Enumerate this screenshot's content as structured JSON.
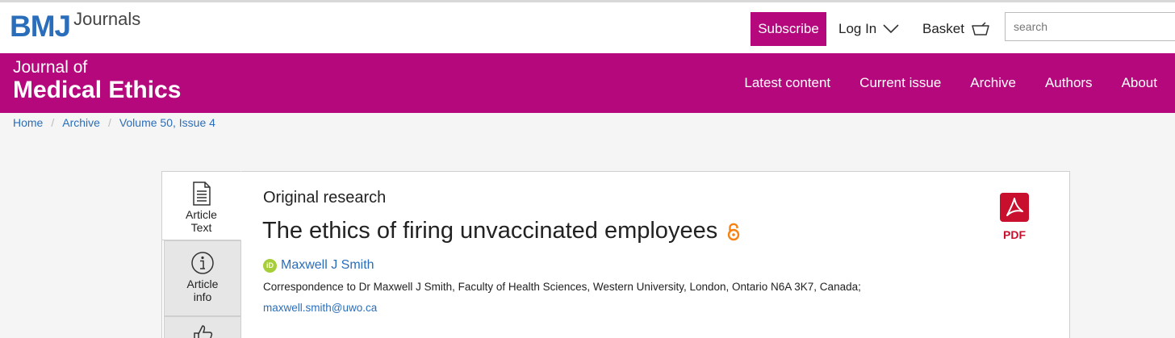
{
  "header": {
    "logo_bmj": "BMJ",
    "logo_journals": "Journals",
    "subscribe_label": "Subscribe",
    "login_label": "Log In",
    "basket_label": "Basket",
    "search_placeholder": "search"
  },
  "journal": {
    "title_line1": "Journal of",
    "title_line2": "Medical Ethics",
    "nav": [
      "Latest content",
      "Current issue",
      "Archive",
      "Authors",
      "About"
    ]
  },
  "breadcrumb": [
    "Home",
    "Archive",
    "Volume 50, Issue 4"
  ],
  "tabs": {
    "article_text": [
      "Article",
      "Text"
    ],
    "article_info": [
      "Article",
      "info"
    ]
  },
  "article": {
    "type": "Original research",
    "title": "The ethics of firing unvaccinated employees",
    "author": "Maxwell J Smith",
    "orcid_badge": "iD",
    "correspondence": "Correspondence to Dr Maxwell J Smith, Faculty of Health Sciences, Western University, London, Ontario N6A 3K7, Canada;",
    "email": "maxwell.smith@uwo.ca",
    "pdf_label": "PDF"
  },
  "colors": {
    "brand_magenta": "#b5087d",
    "link_blue": "#2a6ebb",
    "pdf_red": "#c8102e",
    "open_access_orange": "#f68212",
    "orcid_green": "#a6ce39"
  },
  "icons": [
    "chevron-down-icon",
    "basket-icon",
    "document-icon",
    "info-icon",
    "thumbs-up-icon",
    "open-access-icon",
    "orcid-icon",
    "pdf-icon"
  ]
}
